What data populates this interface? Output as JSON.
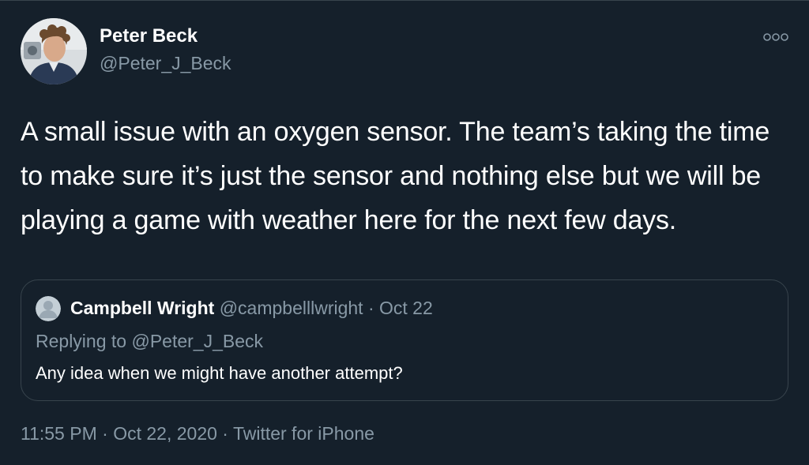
{
  "author": {
    "name": "Peter Beck",
    "handle": "@Peter_J_Beck"
  },
  "tweet": {
    "text": "A small issue with an oxygen sensor. The team’s taking the time to make sure it’s just the sensor and nothing else but we will be playing a game with weather here for the next few days."
  },
  "quoted_tweet": {
    "name": "Campbell Wright",
    "handle": "@campbelllwright",
    "separator": " · ",
    "date": "Oct 22",
    "replying_to_prefix": "Replying to ",
    "replying_to_handle": "@Peter_J_Beck",
    "text": "Any idea when we might have another attempt?"
  },
  "footer": {
    "time": "11:55 PM",
    "separator1": " · ",
    "date": "Oct 22, 2020",
    "separator2": " · ",
    "source": "Twitter for iPhone"
  },
  "icons": {
    "more": "more-options-icon",
    "avatar": "author-avatar",
    "quote_avatar": "default-avatar"
  },
  "colors": {
    "background": "#15202b",
    "text_primary": "#ffffff",
    "text_secondary": "#8899a6",
    "border": "#38444d"
  }
}
